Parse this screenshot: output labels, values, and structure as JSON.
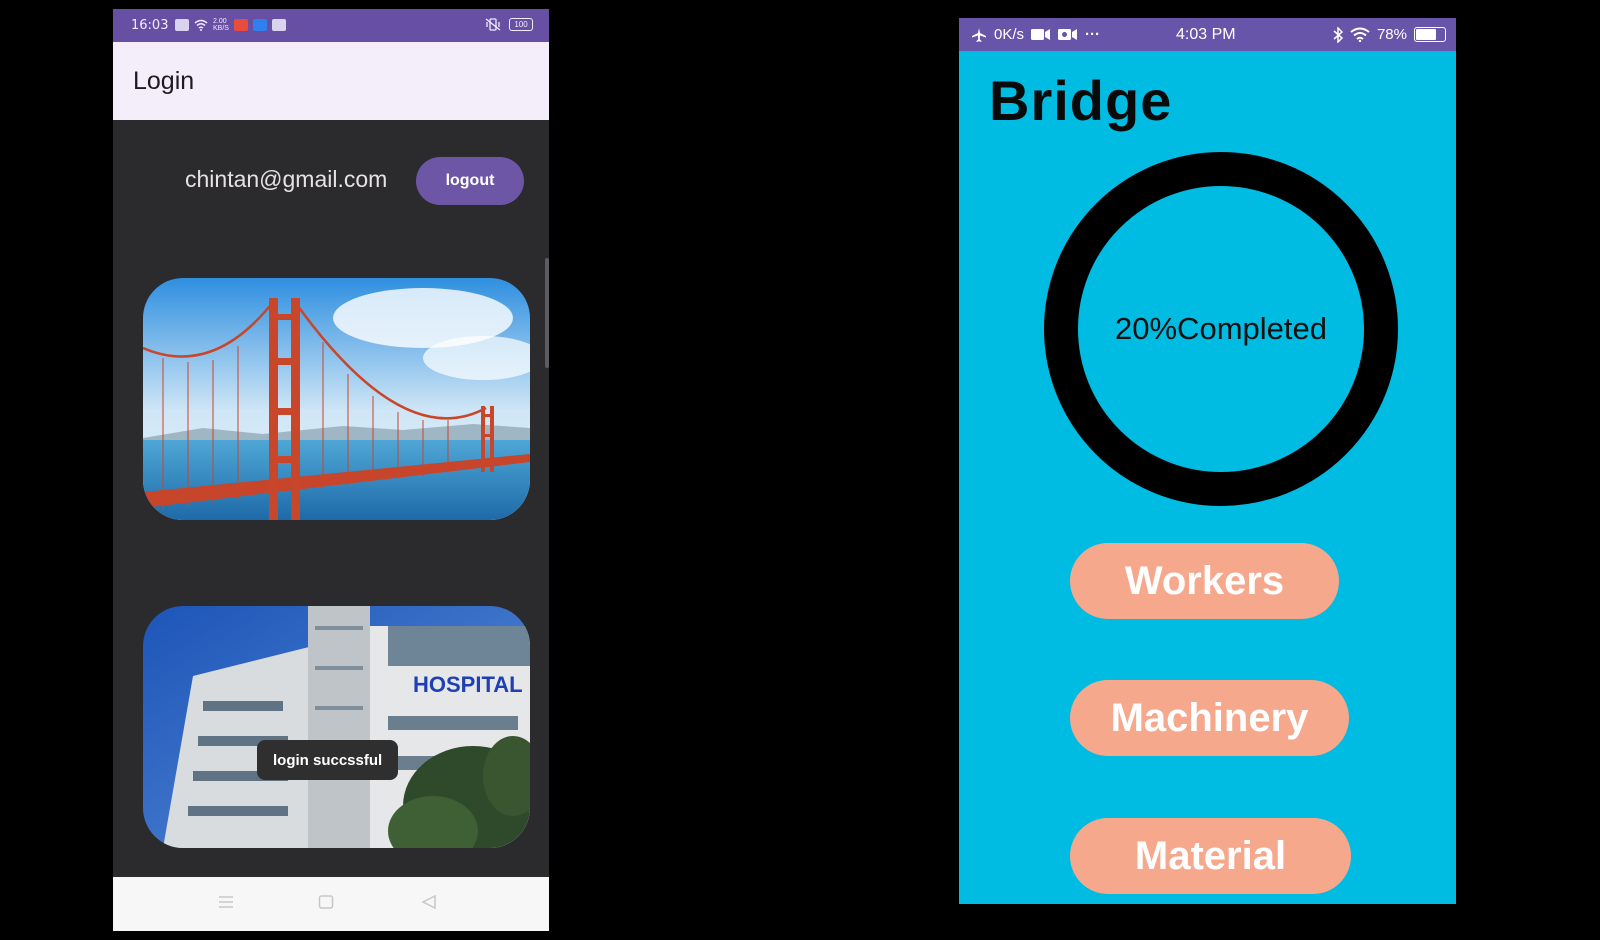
{
  "left_app": {
    "status_bar": {
      "time": "16:03",
      "speed_top": "2.00",
      "speed_bottom": "KB/S",
      "battery": "100"
    },
    "appbar": {
      "title": "Login"
    },
    "user": {
      "email": "chintan@gmail.com"
    },
    "logout_label": "logout",
    "images": [
      {
        "name": "golden-gate-bridge"
      },
      {
        "name": "hospital-building",
        "sign_text": "HOSPITAL"
      }
    ],
    "toast": "login succssful",
    "nav_icons": [
      "menu-icon",
      "home-icon",
      "back-icon"
    ],
    "colors": {
      "status_bar": "#6750a4",
      "appbar": "#f4eefb",
      "background": "#2b2a2c",
      "button": "#6d56a6"
    }
  },
  "right_app": {
    "status_bar": {
      "speed": "0K/s",
      "more": "···",
      "time": "4:03 PM",
      "battery": "78%"
    },
    "title": "Bridge",
    "progress": {
      "percent": 20,
      "label": "20%Completed"
    },
    "buttons": {
      "workers": "Workers",
      "machinery": "Machinery",
      "material": "Material"
    },
    "colors": {
      "background": "#00bce2",
      "status_bar": "#6655a8",
      "button": "#f6a88d",
      "ring": "#000000"
    }
  }
}
